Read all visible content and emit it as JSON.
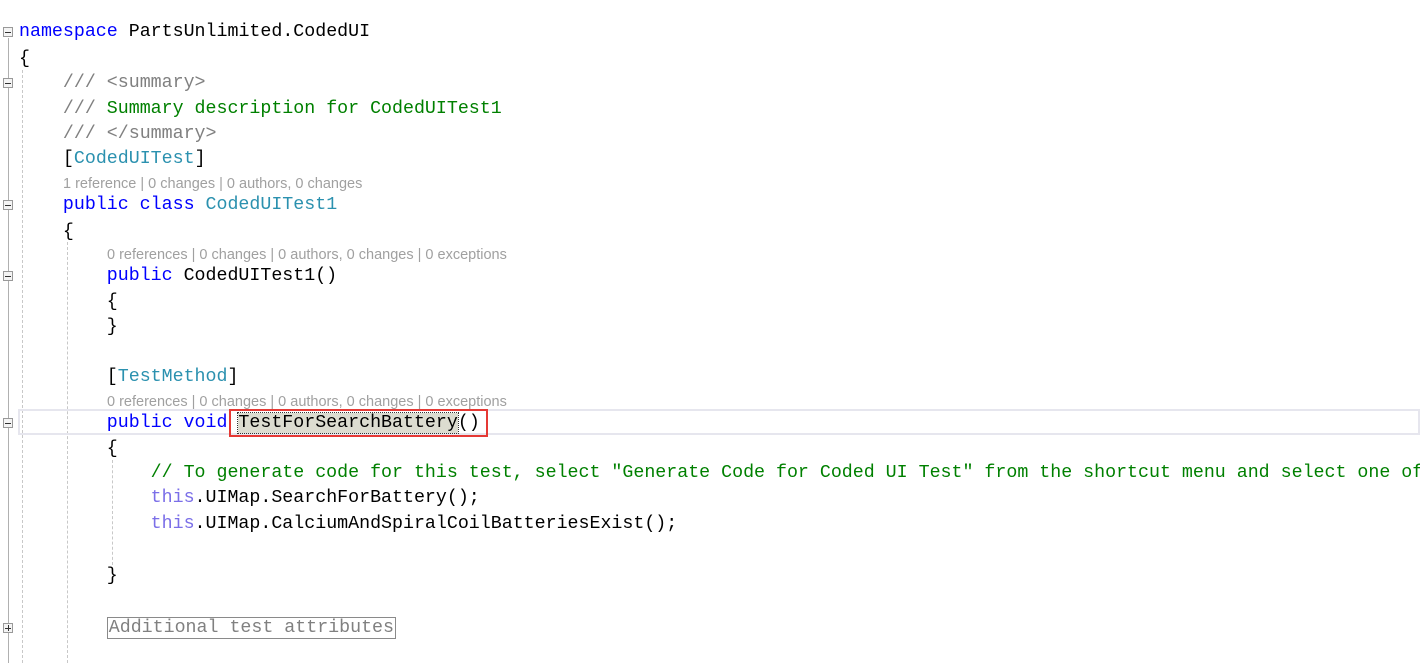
{
  "editor": {
    "namespace_kw": "namespace",
    "namespace_name": "PartsUnlimited.CodedUI",
    "open_brace": "{",
    "close_brace": "}",
    "doc_prefix": "/// ",
    "doc_summary_open": "<summary>",
    "doc_summary_text": "Summary description for CodedUITest1",
    "doc_summary_close": "</summary>",
    "class_attr_open": "[",
    "class_attr": "CodedUITest",
    "class_attr_close": "]",
    "class_lens": "1 reference | 0 changes | 0 authors, 0 changes",
    "class_kw": "public class ",
    "class_name": "CodedUITest1",
    "ctor_lens": "0 references | 0 changes | 0 authors, 0 changes | 0 exceptions",
    "ctor_kw": "public ",
    "ctor_name": "CodedUITest1()",
    "method_attr": "TestMethod",
    "method_lens": "0 references | 0 changes | 0 authors, 0 changes | 0 exceptions",
    "method_kw": "public void ",
    "method_name": "TestForSearchBattery",
    "method_parens": "()",
    "comment": "// To generate code for this test, select \"Generate Code for Coded UI Test\" from the shortcut menu and select one of",
    "this_kw": "this",
    "call1": ".UIMap.SearchForBattery();",
    "call2": ".UIMap.CalciumAndSpiralCoilBatteriesExist();",
    "collapsed_region": "Additional test attributes"
  }
}
